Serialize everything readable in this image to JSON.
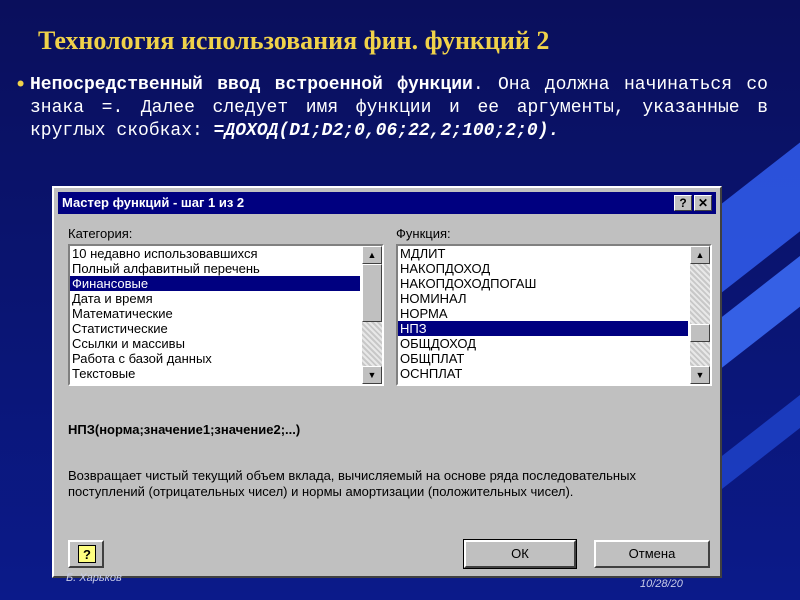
{
  "slide": {
    "title": "Технология использования фин. функций   2",
    "bullet_bold": "Непосредственный ввод встроенной функции",
    "bullet_rest": ". Она должна начинаться со знака =. Далее следует имя функции и ее аргументы, указанные в круглых скобках: ",
    "bullet_formula": "=ДОХОД(D1;D2;0,06;22,2;100;2;0).",
    "footer_left": "Б. Харьков",
    "footer_right": "10/28/20"
  },
  "colors": {
    "title": "#f0d24a",
    "background": "#0a1470",
    "titlebar": "#000080",
    "selection": "#000080"
  },
  "dialog": {
    "title": "Мастер функций - шаг 1 из 2",
    "help_button": "?",
    "close_button": "✕",
    "category_label": "Категория:",
    "function_label": "Функция:",
    "categories": [
      "10 недавно использовавшихся",
      "Полный алфавитный перечень",
      "Финансовые",
      "Дата и время",
      "Математические",
      "Статистические",
      "Ссылки и массивы",
      "Работа с базой данных",
      "Текстовые"
    ],
    "selected_category": "Финансовые",
    "functions": [
      "МДЛИТ",
      "НАКОПДОХОД",
      "НАКОПДОХОДПОГАШ",
      "НОМИНАЛ",
      "НОРМА",
      "НПЗ",
      "ОБЩДОХОД",
      "ОБЩПЛАТ",
      "ОСНПЛАТ"
    ],
    "selected_function": "НПЗ",
    "syntax": "НПЗ(норма;значение1;значение2;...)",
    "description": "Возвращает чистый текущий объем вклада, вычисляемый на основе ряда последовательных поступлений (отрицательных чисел) и нормы амортизации (положительных чисел).",
    "ok_label": "ОК",
    "cancel_label": "Отмена",
    "assistant_icon": "?"
  }
}
